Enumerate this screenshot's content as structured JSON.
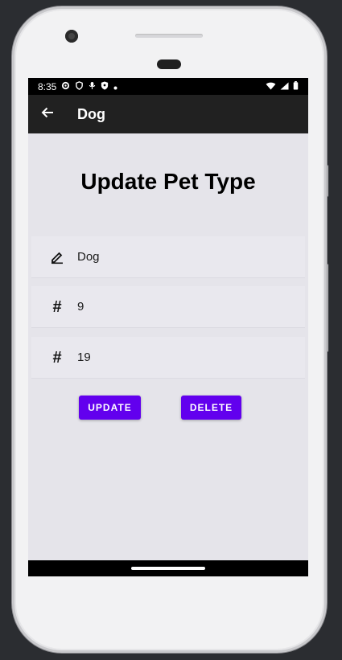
{
  "status_bar": {
    "time": "8:35"
  },
  "app_bar": {
    "title": "Dog"
  },
  "heading": "Update Pet Type",
  "fields": [
    {
      "icon": "edit-icon",
      "value": "Dog"
    },
    {
      "icon": "hash-icon",
      "value": "9"
    },
    {
      "icon": "hash-icon",
      "value": "19"
    }
  ],
  "buttons": {
    "update_label": "UPDATE",
    "delete_label": "DELETE"
  },
  "colors": {
    "accent": "#6200ee",
    "app_bar": "#212121",
    "background": "#e5e4ea"
  }
}
